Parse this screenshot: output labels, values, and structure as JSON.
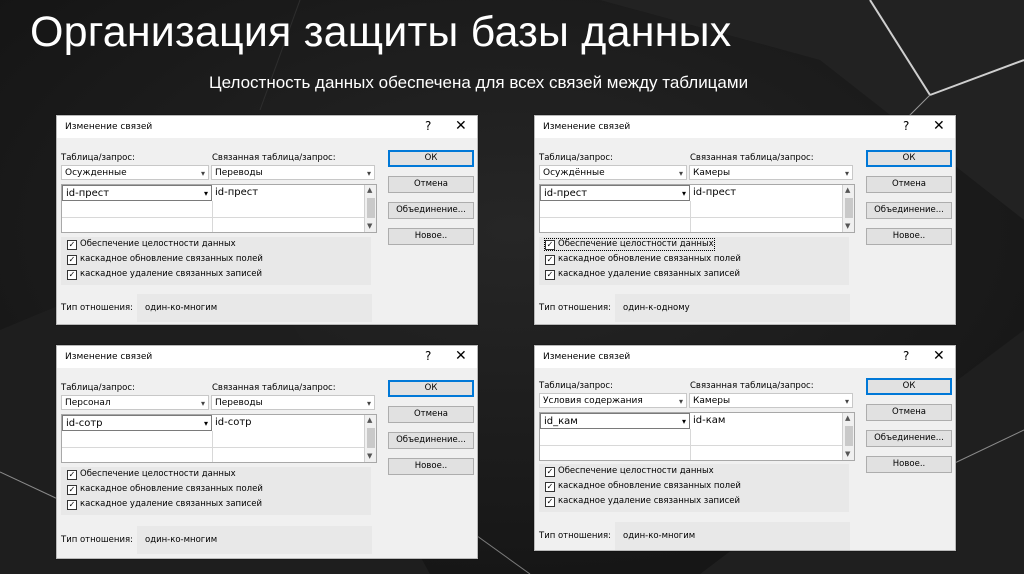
{
  "slide": {
    "title": "Организация защиты базы данных",
    "subtitle": "Целостность данных обеспечена для всех связей между таблицами"
  },
  "dialogs": [
    {
      "title": "Изменение связей",
      "help": "?",
      "close": "✕",
      "table_label": "Таблица/запрос:",
      "related_label": "Связанная таблица/запрос:",
      "table": "Осужденные",
      "related_table": "Переводы",
      "field_left": "id-прест",
      "field_right": "id-прест",
      "ok": "ОК",
      "cancel": "Отмена",
      "join": "Объединение...",
      "new": "Новое..",
      "integrity": "Обеспечение целостности данных",
      "cascade_update": "каскадное обновление связанных полей",
      "cascade_delete": "каскадное удаление связанных записей",
      "reltype_label": "Тип отношения:",
      "reltype_value": "один-ко-многим"
    },
    {
      "title": "Изменение связей",
      "help": "?",
      "close": "✕",
      "table_label": "Таблица/запрос:",
      "related_label": "Связанная таблица/запрос:",
      "table": "Осуждённые",
      "related_table": "Камеры",
      "field_left": "id-прест",
      "field_right": "id-прест",
      "ok": "ОК",
      "cancel": "Отмена",
      "join": "Объединение...",
      "new": "Новое..",
      "integrity": "Обеспечение целостности данных",
      "cascade_update": "каскадное обновление связанных полей",
      "cascade_delete": "каскадное удаление связанных записей",
      "reltype_label": "Тип отношения:",
      "reltype_value": "один-к-одному"
    },
    {
      "title": "Изменение связей",
      "help": "?",
      "close": "✕",
      "table_label": "Таблица/запрос:",
      "related_label": "Связанная таблица/запрос:",
      "table": "Персонал",
      "related_table": "Переводы",
      "field_left": "id-сотр",
      "field_right": "id-сотр",
      "ok": "ОК",
      "cancel": "Отмена",
      "join": "Объединение...",
      "new": "Новое..",
      "integrity": "Обеспечение целостности данных",
      "cascade_update": "каскадное обновление связанных полей",
      "cascade_delete": "каскадное удаление связанных записей",
      "reltype_label": "Тип отношения:",
      "reltype_value": "один-ко-многим"
    },
    {
      "title": "Изменение связей",
      "help": "?",
      "close": "✕",
      "table_label": "Таблица/запрос:",
      "related_label": "Связанная таблица/запрос:",
      "table": "Условия содержания",
      "related_table": "Камеры",
      "field_left": "id_кам",
      "field_right": "id-кам",
      "ok": "ОК",
      "cancel": "Отмена",
      "join": "Объединение...",
      "new": "Новое..",
      "integrity": "Обеспечение целостности данных",
      "cascade_update": "каскадное обновление связанных полей",
      "cascade_delete": "каскадное удаление связанных записей",
      "reltype_label": "Тип отношения:",
      "reltype_value": "один-ко-многим"
    }
  ],
  "icons": {
    "check": "✓",
    "dropdown": "▾",
    "scroll_up": "▲",
    "scroll_down": "▼"
  }
}
